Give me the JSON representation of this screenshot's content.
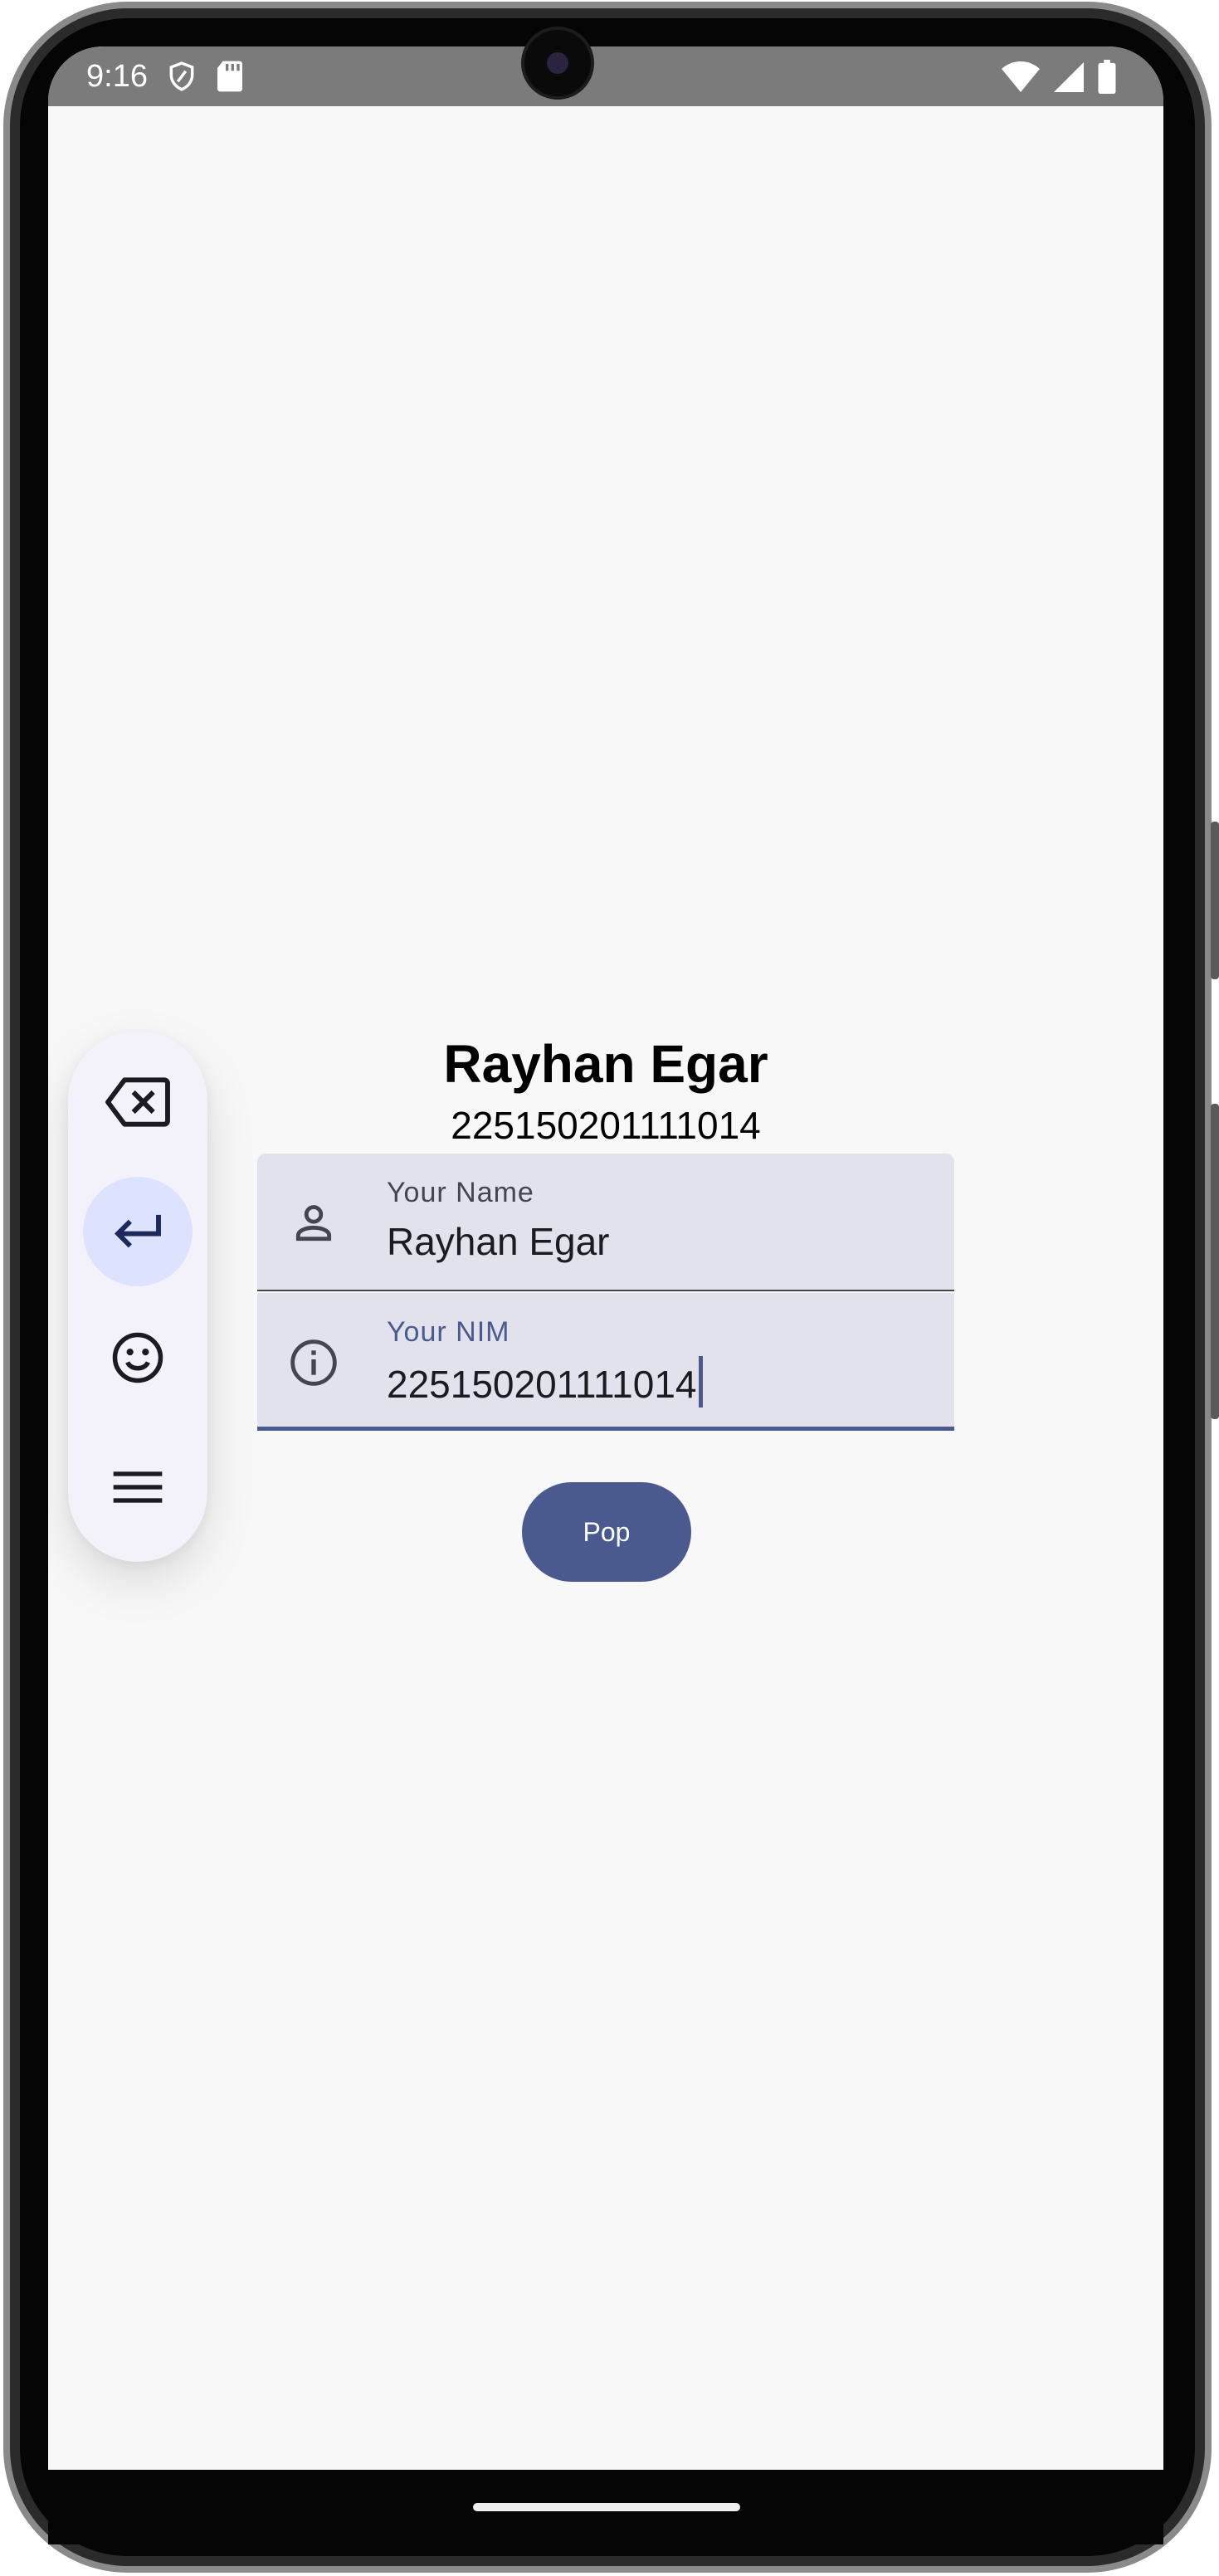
{
  "status_bar": {
    "time": "9:16",
    "left_icons": [
      "shield-icon",
      "sd-card-icon"
    ],
    "right_icons": [
      "wifi-icon",
      "cellular-signal-icon",
      "battery-icon"
    ]
  },
  "header": {
    "name": "Rayhan Egar",
    "nim": "225150201111014"
  },
  "form": {
    "name_field": {
      "label": "Your Name",
      "value": "Rayhan Egar",
      "icon": "person-icon"
    },
    "nim_field": {
      "label": "Your NIM",
      "value": "225150201111014",
      "icon": "info-icon",
      "focused": true
    },
    "pop_button_label": "Pop"
  },
  "floating_toolbar": {
    "items": [
      "backspace-icon",
      "enter-icon",
      "emoji-icon",
      "menu-icon"
    ],
    "active_item": "enter-icon"
  },
  "colors": {
    "primary": "#4a5a8f",
    "field_background": "#e2e2ec",
    "screen_background": "#f8f8f9",
    "toolbar_background": "#f3f2fb",
    "toolbar_active": "#dde3ff"
  }
}
